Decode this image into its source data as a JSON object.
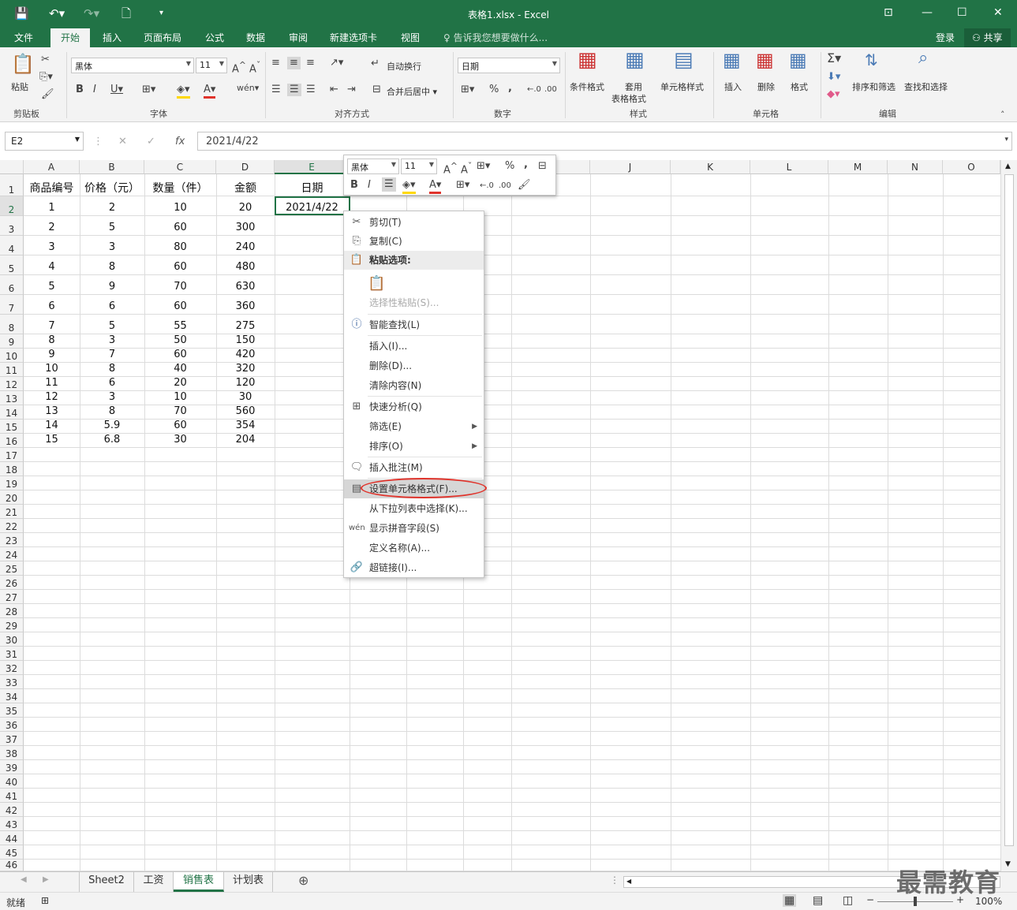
{
  "window": {
    "title": "表格1.xlsx - Excel",
    "login": "登录",
    "share": "共享"
  },
  "menu_tabs": [
    "文件",
    "开始",
    "插入",
    "页面布局",
    "公式",
    "数据",
    "审阅",
    "新建选项卡",
    "视图"
  ],
  "tell_me": "告诉我您想要做什么...",
  "ribbon": {
    "clipboard": {
      "paste": "粘贴",
      "group": "剪贴板"
    },
    "font": {
      "name": "黑体",
      "size": "11",
      "group": "字体"
    },
    "alignment": {
      "wrap": "自动换行",
      "merge": "合并后居中",
      "group": "对齐方式"
    },
    "number": {
      "format": "日期",
      "percent": "%",
      "comma": ",",
      "group": "数字"
    },
    "styles": {
      "conditional": "条件格式",
      "table1": "套用",
      "table2": "表格格式",
      "cell_styles": "单元格样式",
      "group": "样式"
    },
    "cells": {
      "insert": "插入",
      "delete": "删除",
      "format": "格式",
      "group": "单元格"
    },
    "editing": {
      "sort_filter": "排序和筛选",
      "find_select": "查找和选择",
      "group": "编辑"
    }
  },
  "formula_bar": {
    "name_box": "E2",
    "fx": "fx",
    "value": "2021/4/22"
  },
  "columns": [
    "A",
    "B",
    "C",
    "D",
    "E",
    "F",
    "G",
    "H",
    "I",
    "J",
    "K",
    "L",
    "M",
    "N",
    "O"
  ],
  "row_numbers": [
    "1",
    "2",
    "3",
    "4",
    "5",
    "6",
    "7",
    "8",
    "9",
    "10",
    "11",
    "12",
    "13",
    "14",
    "15",
    "16",
    "17",
    "18",
    "19",
    "20",
    "21",
    "22",
    "23",
    "24",
    "25",
    "26",
    "27",
    "28",
    "29",
    "30",
    "31",
    "32",
    "33",
    "34",
    "35",
    "36",
    "37",
    "38",
    "39",
    "40",
    "41",
    "42",
    "43",
    "44",
    "45",
    "46"
  ],
  "sheet_data": [
    [
      "商品编号",
      "价格（元）",
      "数量（件）",
      "金额",
      "日期"
    ],
    [
      "1",
      "2",
      "10",
      "20",
      "2021/4/22"
    ],
    [
      "2",
      "5",
      "60",
      "300",
      ""
    ],
    [
      "3",
      "3",
      "80",
      "240",
      ""
    ],
    [
      "4",
      "8",
      "60",
      "480",
      ""
    ],
    [
      "5",
      "9",
      "70",
      "630",
      ""
    ],
    [
      "6",
      "6",
      "60",
      "360",
      ""
    ],
    [
      "7",
      "5",
      "55",
      "275",
      ""
    ],
    [
      "8",
      "3",
      "50",
      "150",
      ""
    ],
    [
      "9",
      "7",
      "60",
      "420",
      ""
    ],
    [
      "10",
      "8",
      "40",
      "320",
      ""
    ],
    [
      "11",
      "6",
      "20",
      "120",
      ""
    ],
    [
      "12",
      "3",
      "10",
      "30",
      ""
    ],
    [
      "13",
      "8",
      "70",
      "560",
      ""
    ],
    [
      "14",
      "5.9",
      "60",
      "354",
      ""
    ],
    [
      "15",
      "6.8",
      "30",
      "204",
      ""
    ]
  ],
  "mini_toolbar": {
    "font": "黑体",
    "size": "11",
    "percent": "%",
    "comma": ","
  },
  "context_menu": {
    "cut": "剪切(T)",
    "copy": "复制(C)",
    "paste_options": "粘贴选项:",
    "paste_special": "选择性粘贴(S)...",
    "smart_lookup": "智能查找(L)",
    "insert": "插入(I)...",
    "delete": "删除(D)...",
    "clear": "清除内容(N)",
    "quick_analysis": "快速分析(Q)",
    "filter": "筛选(E)",
    "sort": "排序(O)",
    "insert_comment": "插入批注(M)",
    "format_cells": "设置单元格格式(F)...",
    "pick_list": "从下拉列表中选择(K)...",
    "phonetic": "显示拼音字段(S)",
    "define_name": "定义名称(A)...",
    "hyperlink": "超链接(I)..."
  },
  "sheet_tabs": [
    "Sheet2",
    "工资",
    "销售表",
    "计划表"
  ],
  "active_sheet": "销售表",
  "status": {
    "ready": "就绪",
    "zoom": "100%"
  },
  "watermark": "最需教育",
  "colors": {
    "brand": "#217346",
    "highlight_ring": "#e0332b"
  }
}
